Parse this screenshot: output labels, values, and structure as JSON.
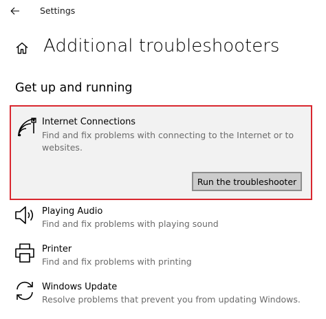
{
  "window": {
    "title": "Settings",
    "back_icon": "back-arrow-icon"
  },
  "page": {
    "title": "Additional troubleshooters",
    "home_icon": "home-icon"
  },
  "section": {
    "heading": "Get up and running"
  },
  "troubleshooters": [
    {
      "title": "Internet Connections",
      "description": "Find and fix problems with connecting to the Internet or to websites.",
      "icon": "network-icon",
      "selected": true,
      "button_label": "Run the troubleshooter"
    },
    {
      "title": "Playing Audio",
      "description": "Find and fix problems with playing sound",
      "icon": "speaker-icon"
    },
    {
      "title": "Printer",
      "description": "Find and fix problems with printing",
      "icon": "printer-icon"
    },
    {
      "title": "Windows Update",
      "description": "Resolve problems that prevent you from updating Windows.",
      "icon": "sync-icon"
    }
  ],
  "colors": {
    "highlight_border": "#d9262e",
    "card_background": "#f2f2f2",
    "secondary_text": "#6b6b6b",
    "button_background": "#cccccc"
  }
}
